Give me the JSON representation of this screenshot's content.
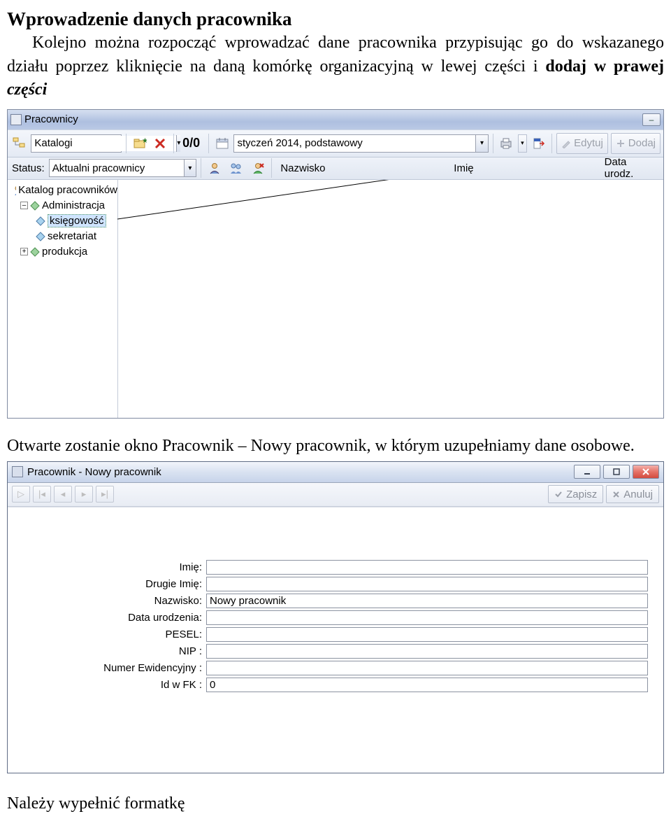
{
  "doc": {
    "title": "Wprowadzenie danych pracownika",
    "para1_a": "Kolejno można rozpocząć wprowadzać dane pracownika przypisując go do wskazanego działu poprzez kliknięcie na daną komórkę organizacyjną w lewej części i ",
    "para1_bold": "dodaj w prawej ",
    "para1_italic": "części",
    "para2_a": "Otwarte zostanie okno ",
    "para2_b": "Pracownik – Nowy pracownik",
    "para2_c": ", w którym uzupełniamy dane osobowe.",
    "footer": "Należy wypełnić formatkę"
  },
  "win1": {
    "title": "Pracownicy",
    "catalogs_label": "Katalogi",
    "count": "0/0",
    "period_value": "styczeń 2014, podstawowy",
    "edit_label": "Edytuj",
    "add_label": "Dodaj",
    "status_label": "Status:",
    "status_value": "Aktualni pracownicy",
    "col_nazwisko": "Nazwisko",
    "col_imie": "Imię",
    "col_data": "Data urodz.",
    "tree": {
      "root": "Katalog pracowników",
      "n1": "Administracja",
      "n1a": "księgowość",
      "n1b": "sekretariat",
      "n2": "produkcja"
    }
  },
  "win2": {
    "title": "Pracownik - Nowy pracownik",
    "btn_zapisz": "Zapisz",
    "btn_anuluj": "Anuluj",
    "fields": {
      "imie_label": "Imię:",
      "imie_val": "",
      "drugie_label": "Drugie Imię:",
      "drugie_val": "",
      "nazwisko_label": "Nazwisko:",
      "nazwisko_val": "Nowy pracownik",
      "data_label": "Data urodzenia:",
      "data_val": "",
      "pesel_label": "PESEL:",
      "pesel_val": "",
      "nip_label": "NIP :",
      "nip_val": "",
      "numer_label": "Numer Ewidencyjny :",
      "numer_val": "",
      "idfk_label": "Id w FK :",
      "idfk_val": "0"
    }
  }
}
